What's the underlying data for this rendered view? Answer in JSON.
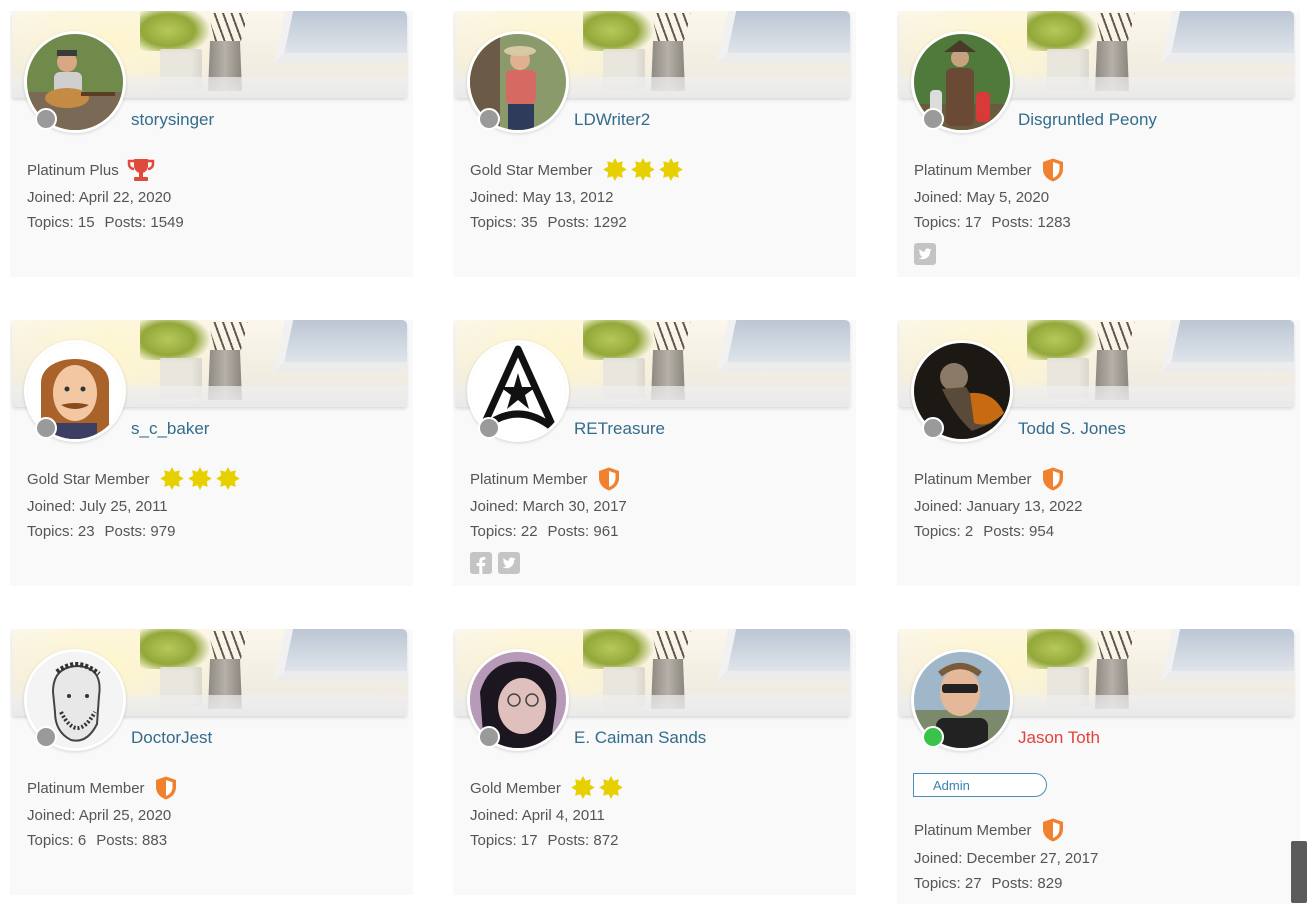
{
  "colors": {
    "username": "#336c8c",
    "admin_username": "#e5413b",
    "text": "#555555",
    "trophy": "#e04a3b",
    "shield": "#f0822f",
    "star": "#e6d000",
    "offline": "#9a9a9a",
    "online": "#3ac34c"
  },
  "members": [
    {
      "username": "storysinger",
      "status": "offline",
      "rank": "Platinum Plus",
      "rank_icon": "trophy-icon",
      "joined": "Joined: April 22, 2020",
      "topics": "Topics: 15",
      "posts": "Posts: 1549",
      "socials": []
    },
    {
      "username": "LDWriter2",
      "status": "offline",
      "rank": "Gold Star Member",
      "rank_icon": "star-icon x3",
      "joined": "Joined: May 13, 2012",
      "topics": "Topics: 35",
      "posts": "Posts: 1292",
      "socials": []
    },
    {
      "username": "Disgruntled Peony",
      "status": "offline",
      "rank": "Platinum Member",
      "rank_icon": "shield-icon",
      "joined": "Joined: May 5, 2020",
      "topics": "Topics: 17",
      "posts": "Posts: 1283",
      "socials": [
        "twitter-icon"
      ]
    },
    {
      "username": "s_c_baker",
      "status": "offline",
      "rank": "Gold Star Member",
      "rank_icon": "star-icon x3",
      "joined": "Joined: July 25, 2011",
      "topics": "Topics: 23",
      "posts": "Posts: 979",
      "socials": []
    },
    {
      "username": "RETreasure",
      "status": "offline",
      "rank": "Platinum Member",
      "rank_icon": "shield-icon",
      "joined": "Joined: March 30, 2017",
      "topics": "Topics: 22",
      "posts": "Posts: 961",
      "socials": [
        "facebook-icon",
        "twitter-icon"
      ]
    },
    {
      "username": "Todd S. Jones",
      "status": "offline",
      "rank": "Platinum Member",
      "rank_icon": "shield-icon",
      "joined": "Joined: January 13, 2022",
      "topics": "Topics: 2",
      "posts": "Posts: 954",
      "socials": []
    },
    {
      "username": "DoctorJest",
      "status": "offline",
      "rank": "Platinum Member",
      "rank_icon": "shield-icon",
      "joined": "Joined: April 25, 2020",
      "topics": "Topics: 6",
      "posts": "Posts: 883",
      "socials": []
    },
    {
      "username": "E. Caiman Sands",
      "status": "offline",
      "rank": "Gold Member",
      "rank_icon": "star-icon x2",
      "joined": "Joined: April 4, 2011",
      "topics": "Topics: 17",
      "posts": "Posts: 872",
      "socials": []
    },
    {
      "username": "Jason Toth",
      "status": "online",
      "badge": "Admin",
      "rank": "Platinum Member",
      "rank_icon": "shield-icon",
      "joined": "Joined: December 27, 2017",
      "topics": "Topics: 27",
      "posts": "Posts: 829",
      "socials": []
    }
  ]
}
